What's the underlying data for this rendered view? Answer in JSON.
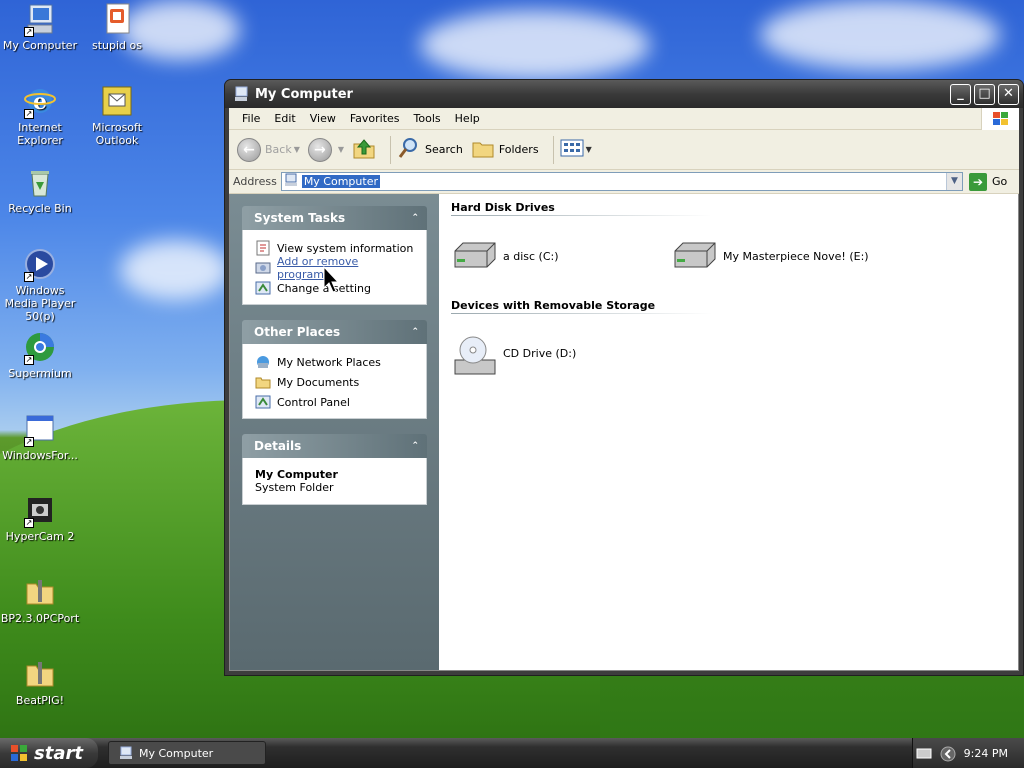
{
  "desktop": {
    "icons": [
      {
        "label": "My Computer",
        "icon": "my-computer-icon"
      },
      {
        "label": "stupid os",
        "icon": "document-icon"
      },
      {
        "label": "Internet Explorer",
        "icon": "internet-explorer-icon"
      },
      {
        "label": "Microsoft Outlook",
        "icon": "outlook-icon"
      },
      {
        "label": "Recycle Bin",
        "icon": "recycle-bin-icon"
      },
      {
        "label": "Windows Media Player 50(p)",
        "icon": "media-player-icon"
      },
      {
        "label": "Supermium",
        "icon": "browser-icon"
      },
      {
        "label": "WindowsFor...",
        "icon": "window-icon"
      },
      {
        "label": "HyperCam 2",
        "icon": "camera-icon"
      },
      {
        "label": "BP2.3.0PCPort",
        "icon": "zip-folder-icon"
      },
      {
        "label": "BeatPIG!",
        "icon": "zip-folder-icon"
      }
    ]
  },
  "window": {
    "title": "My Computer",
    "menu": [
      "File",
      "Edit",
      "View",
      "Favorites",
      "Tools",
      "Help"
    ],
    "toolbar": {
      "back": "Back",
      "search": "Search",
      "folders": "Folders"
    },
    "address": {
      "label": "Address",
      "value": "My Computer",
      "go": "Go"
    },
    "tasks": {
      "system": {
        "title": "System Tasks",
        "items": [
          "View system information",
          "Add or remove programs",
          "Change a setting"
        ]
      },
      "other": {
        "title": "Other Places",
        "items": [
          "My Network Places",
          "My Documents",
          "Control Panel"
        ]
      },
      "details": {
        "title": "Details",
        "name": "My Computer",
        "type": "System Folder"
      }
    },
    "sections": {
      "hdd": {
        "title": "Hard Disk Drives",
        "drives": [
          "a disc (C:)",
          "My Masterpiece Nove! (E:)"
        ]
      },
      "removable": {
        "title": "Devices with Removable Storage",
        "drives": [
          "CD Drive (D:)"
        ]
      }
    }
  },
  "taskbar": {
    "start": "start",
    "task": "My Computer",
    "time": "9:24 PM"
  }
}
